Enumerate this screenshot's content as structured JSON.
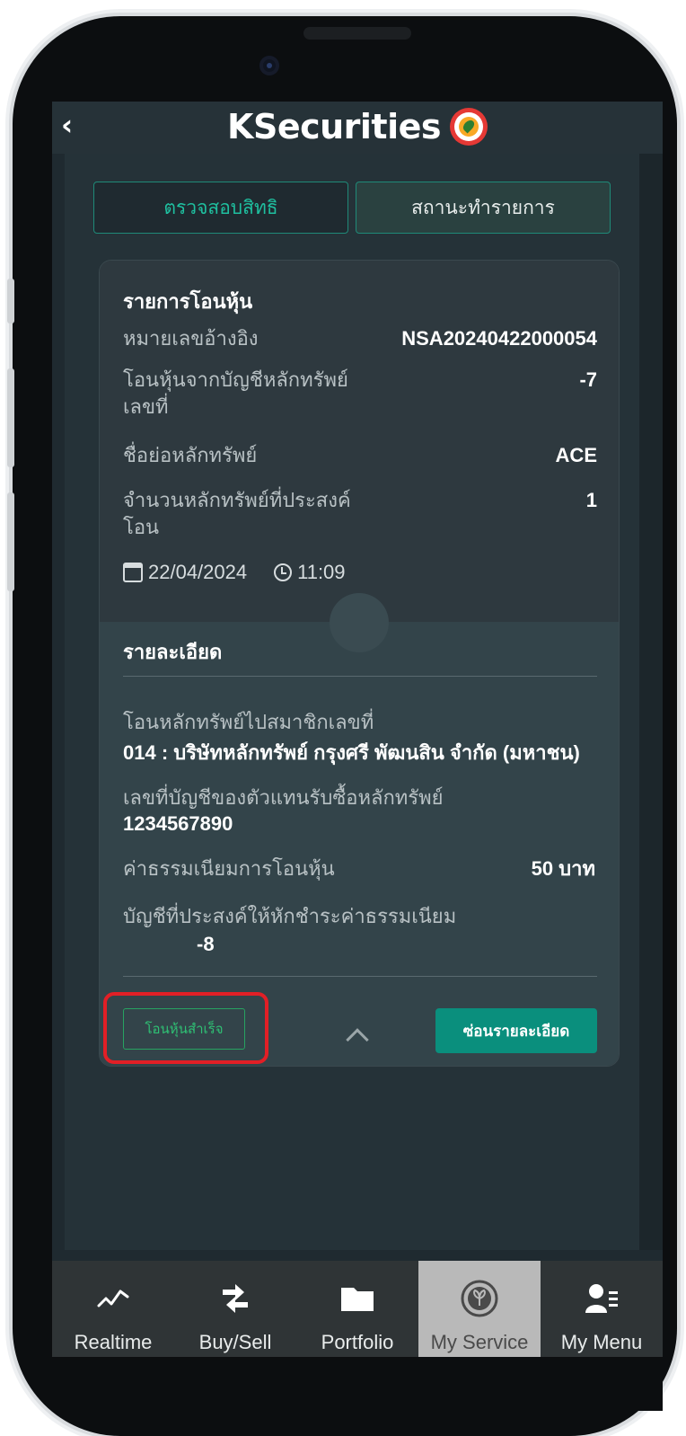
{
  "header": {
    "back_icon": "chevron-left-icon",
    "brand": "KSecurities"
  },
  "tabs": [
    {
      "label": "ตรวจสอบสิทธิ",
      "active": false
    },
    {
      "label": "สถานะทำรายการ",
      "active": true
    }
  ],
  "card": {
    "title": "รายการโอนหุ้น",
    "ref_label": "หมายเลขอ้างอิง",
    "ref_value": "NSA20240422000054",
    "from_account_label": "โอนหุ้นจากบัญชีหลักทรัพย์\nเลขที่",
    "from_account_value": "-7",
    "symbol_label": "ชื่อย่อหลักทรัพย์",
    "symbol_value": "ACE",
    "qty_label": "จำนวนหลักทรัพย์ที่ประสงค์\nโอน",
    "qty_value": "1",
    "date": "22/04/2024",
    "time": "11:09"
  },
  "details": {
    "title": "รายละเอียด",
    "to_member_label": "โอนหลักทรัพย์ไปสมาชิกเลขที่",
    "to_member_value": "014 : บริษัทหลักทรัพย์ กรุงศรี พัฒนสิน จำกัด (มหาชน)",
    "agent_account_label": "เลขที่บัญชีของตัวแทนรับซื้อหลักทรัพย์",
    "agent_account_value": "1234567890",
    "fee_label": "ค่าธรรมเนียมการโอนหุ้น",
    "fee_value": "50 บาท",
    "fee_account_label": "บัญชีที่ประสงค์ให้หักชำระค่าธรรมเนียม",
    "fee_account_value": "-8"
  },
  "actions": {
    "status_badge": "โอนหุ้นสำเร็จ",
    "hide_details": "ซ่อนรายละเอียด"
  },
  "bottom_nav": [
    {
      "label": "Realtime",
      "icon": "line-chart-icon",
      "active": false
    },
    {
      "label": "Buy/Sell",
      "icon": "swap-arrows-icon",
      "active": false
    },
    {
      "label": "Portfolio",
      "icon": "folder-icon",
      "active": false
    },
    {
      "label": "My Service",
      "icon": "plant-logo-icon",
      "active": true
    },
    {
      "label": "My Menu",
      "icon": "user-menu-icon",
      "active": false
    }
  ],
  "colors": {
    "accent": "#1fbf9f",
    "button": "#0a8f7d",
    "success": "#2fc074",
    "highlight": "#e21f26"
  }
}
